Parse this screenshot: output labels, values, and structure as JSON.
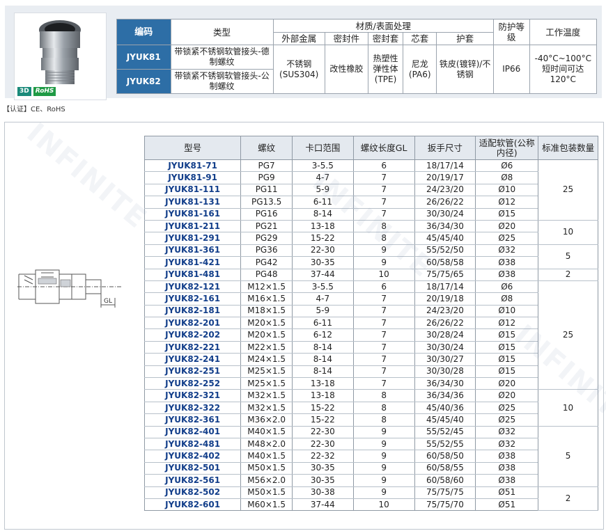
{
  "spec": {
    "headers": {
      "code": "编码",
      "type": "类型",
      "material": "材质/表面处理",
      "protection": "防护等级",
      "temperature": "工作温度",
      "outer_metal": "外部金属",
      "seal": "密封件",
      "seal_sleeve": "密封套",
      "core": "芯套",
      "guard": "护套"
    },
    "rows": [
      {
        "code": "JYUK81",
        "type": "带锁紧不锈钢软管接头-德制螺纹"
      },
      {
        "code": "JYUK82",
        "type": "带锁紧不锈钢软管接头-公制螺纹"
      }
    ],
    "outer_metal": "不锈钢(SUS304)",
    "seal": "改性橡胶",
    "seal_sleeve": "热塑性弹性体(TPE)",
    "core": "尼龙(PA6)",
    "guard": "铁皮(镀锌)/不锈钢",
    "protection": "IP66",
    "temperature": "-40°C~100°C 短时间可达120°C"
  },
  "badges": {
    "b3d": "3D",
    "rohs": "RoHS"
  },
  "certification": "【认证】CE、RoHS",
  "drawing": {
    "gl_label": "GL"
  },
  "table": {
    "headers": {
      "model": "型号",
      "thread": "螺纹",
      "clamp": "卡口范围",
      "gl": "螺纹长度GL",
      "wrench": "扳手尺寸",
      "hose": "适配软管(公称内径)",
      "pack": "标准包装数量"
    },
    "rows": [
      {
        "model": "JYUK81-71",
        "thread": "PG7",
        "clamp": "3-5.5",
        "gl": "6",
        "wrench": "18/17/14",
        "hose": "Ø6"
      },
      {
        "model": "JYUK81-91",
        "thread": "PG9",
        "clamp": "4-7",
        "gl": "7",
        "wrench": "20/19/17",
        "hose": "Ø8"
      },
      {
        "model": "JYUK81-111",
        "thread": "PG11",
        "clamp": "5-9",
        "gl": "7",
        "wrench": "24/23/20",
        "hose": "Ø10"
      },
      {
        "model": "JYUK81-131",
        "thread": "PG13.5",
        "clamp": "6-11",
        "gl": "7",
        "wrench": "26/26/22",
        "hose": "Ø12"
      },
      {
        "model": "JYUK81-161",
        "thread": "PG16",
        "clamp": "8-14",
        "gl": "7",
        "wrench": "30/30/24",
        "hose": "Ø15"
      },
      {
        "model": "JYUK81-211",
        "thread": "PG21",
        "clamp": "13-18",
        "gl": "8",
        "wrench": "36/34/30",
        "hose": "Ø20"
      },
      {
        "model": "JYUK81-291",
        "thread": "PG29",
        "clamp": "15-22",
        "gl": "8",
        "wrench": "45/45/40",
        "hose": "Ø25"
      },
      {
        "model": "JYUK81-361",
        "thread": "PG36",
        "clamp": "22-30",
        "gl": "9",
        "wrench": "55/52/50",
        "hose": "Ø32"
      },
      {
        "model": "JYUK81-421",
        "thread": "PG42",
        "clamp": "30-35",
        "gl": "9",
        "wrench": "60/58/58",
        "hose": "Ø38"
      },
      {
        "model": "JYUK81-481",
        "thread": "PG48",
        "clamp": "37-44",
        "gl": "10",
        "wrench": "75/75/65",
        "hose": "Ø38"
      },
      {
        "model": "JYUK82-121",
        "thread": "M12×1.5",
        "clamp": "3-5.5",
        "gl": "6",
        "wrench": "18/17/14",
        "hose": "Ø6"
      },
      {
        "model": "JYUK82-161",
        "thread": "M16×1.5",
        "clamp": "4-7",
        "gl": "7",
        "wrench": "20/19/18",
        "hose": "Ø8"
      },
      {
        "model": "JYUK82-181",
        "thread": "M18×1.5",
        "clamp": "5-9",
        "gl": "7",
        "wrench": "24/23/20",
        "hose": "Ø10"
      },
      {
        "model": "JYUK82-201",
        "thread": "M20×1.5",
        "clamp": "6-11",
        "gl": "7",
        "wrench": "26/26/22",
        "hose": "Ø12"
      },
      {
        "model": "JYUK82-202",
        "thread": "M20×1.5",
        "clamp": "6-12",
        "gl": "7",
        "wrench": "30/28/24",
        "hose": "Ø15"
      },
      {
        "model": "JYUK82-221",
        "thread": "M22×1.5",
        "clamp": "8-14",
        "gl": "7",
        "wrench": "30/30/24",
        "hose": "Ø15"
      },
      {
        "model": "JYUK82-241",
        "thread": "M24×1.5",
        "clamp": "8-14",
        "gl": "7",
        "wrench": "30/30/27",
        "hose": "Ø15"
      },
      {
        "model": "JYUK82-251",
        "thread": "M25×1.5",
        "clamp": "8-14",
        "gl": "7",
        "wrench": "30/30/28",
        "hose": "Ø15"
      },
      {
        "model": "JYUK82-252",
        "thread": "M25×1.5",
        "clamp": "13-18",
        "gl": "7",
        "wrench": "36/34/30",
        "hose": "Ø20"
      },
      {
        "model": "JYUK82-321",
        "thread": "M32×1.5",
        "clamp": "13-18",
        "gl": "8",
        "wrench": "36/34/36",
        "hose": "Ø20"
      },
      {
        "model": "JYUK82-322",
        "thread": "M32×1.5",
        "clamp": "15-22",
        "gl": "8",
        "wrench": "45/40/36",
        "hose": "Ø25"
      },
      {
        "model": "JYUK82-361",
        "thread": "M36×2.0",
        "clamp": "15-22",
        "gl": "8",
        "wrench": "45/45/40",
        "hose": "Ø25"
      },
      {
        "model": "JYUK82-401",
        "thread": "M40×1.5",
        "clamp": "22-30",
        "gl": "9",
        "wrench": "55/52/45",
        "hose": "Ø32"
      },
      {
        "model": "JYUK82-481",
        "thread": "M48×2.0",
        "clamp": "22-30",
        "gl": "9",
        "wrench": "55/52/55",
        "hose": "Ø32"
      },
      {
        "model": "JYUK82-402",
        "thread": "M40×1.5",
        "clamp": "22-32",
        "gl": "9",
        "wrench": "60/58/50",
        "hose": "Ø38"
      },
      {
        "model": "JYUK82-501",
        "thread": "M50×1.5",
        "clamp": "30-35",
        "gl": "9",
        "wrench": "60/58/55",
        "hose": "Ø38"
      },
      {
        "model": "JYUK82-561",
        "thread": "M56×2.0",
        "clamp": "30-35",
        "gl": "9",
        "wrench": "60/58/60",
        "hose": "Ø38"
      },
      {
        "model": "JYUK82-502",
        "thread": "M50×1.5",
        "clamp": "30-38",
        "gl": "9",
        "wrench": "75/75/75",
        "hose": "Ø51"
      },
      {
        "model": "JYUK82-601",
        "thread": "M60×1.5",
        "clamp": "37-44",
        "gl": "10",
        "wrench": "75/75/70",
        "hose": "Ø51"
      }
    ],
    "pack_groups": [
      {
        "value": "25",
        "rows": 5
      },
      {
        "value": "10",
        "rows": 2
      },
      {
        "value": "5",
        "rows": 2
      },
      {
        "value": "2",
        "rows": 1
      },
      {
        "value": "25",
        "rows": 9
      },
      {
        "value": "10",
        "rows": 3
      },
      {
        "value": "5",
        "rows": 5
      },
      {
        "value": "2",
        "rows": 2
      }
    ]
  },
  "colors": {
    "header_blue": "#2d6ea6",
    "model_text": "#123e8a",
    "header_gray": "#e4e9ef"
  }
}
